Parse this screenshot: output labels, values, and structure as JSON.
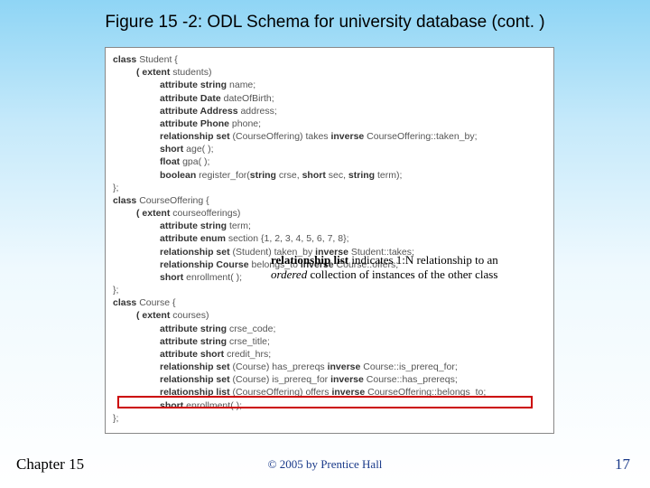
{
  "title": "Figure 15 -2: ODL Schema for university database (cont. )",
  "code": {
    "l1a": "class",
    "l1b": " Student {",
    "l2a": "( extent",
    "l2b": " students)",
    "l3a": "attribute string",
    "l3b": " name;",
    "l4a": "attribute Date",
    "l4b": " dateOfBirth;",
    "l5a": "attribute Address",
    "l5b": " address;",
    "l6a": "attribute Phone",
    "l6b": " phone;",
    "l7a": "relationship set",
    "l7b": " (CourseOffering) takes ",
    "l7c": "inverse",
    "l7d": " CourseOffering::taken_by;",
    "l8a": "short",
    "l8b": " age( );",
    "l9a": "float",
    "l9b": " gpa( );",
    "l10a": "boolean",
    "l10b": " register_for(",
    "l10c": "string",
    "l10d": " crse, ",
    "l10e": "short",
    "l10f": " sec, ",
    "l10g": "string",
    "l10h": " term);",
    "l11": "};",
    "l12a": "class",
    "l12b": " CourseOffering {",
    "l13a": "( extent",
    "l13b": " courseofferings)",
    "l14a": "attribute string",
    "l14b": " term;",
    "l15a": "attribute enum",
    "l15b": " section {1, 2, 3, 4, 5, 6, 7, 8};",
    "l16a": "relationship set",
    "l16b": " (Student) taken_by ",
    "l16c": "inverse",
    "l16d": " Student::takes;",
    "l17a": "relationship Course",
    "l17b": " belongs_to ",
    "l17c": "inverse",
    "l17d": " Course::offers;",
    "l18a": "short",
    "l18b": " enrollment( );",
    "l19": "};",
    "l20a": "class",
    "l20b": " Course {",
    "l21a": "( extent",
    "l21b": " courses)",
    "l22a": "attribute string",
    "l22b": " crse_code;",
    "l23a": "attribute string",
    "l23b": " crse_title;",
    "l24a": "attribute short",
    "l24b": " credit_hrs;",
    "l25a": "relationship set",
    "l25b": " (Course) has_prereqs ",
    "l25c": "inverse",
    "l25d": " Course::is_prereq_for;",
    "l26a": "relationship set",
    "l26b": " (Course) is_prereq_for ",
    "l26c": "inverse",
    "l26d": " Course::has_prereqs;",
    "l27a": "relationship list",
    "l27b": " (CourseOffering) offers ",
    "l27c": "inverse",
    "l27d": " CourseOffering::belongs_to;",
    "l28a": "short",
    "l28b": " enrollment( );",
    "l29": "};"
  },
  "annotation": {
    "bold": "relationship list",
    "part1": " indicates 1:N relationship to an ",
    "italic": "ordered",
    "part2": " collection of instances of the other class"
  },
  "footer": {
    "chapter": "Chapter 15",
    "copyright": "© 2005 by Prentice Hall",
    "page": "17"
  }
}
